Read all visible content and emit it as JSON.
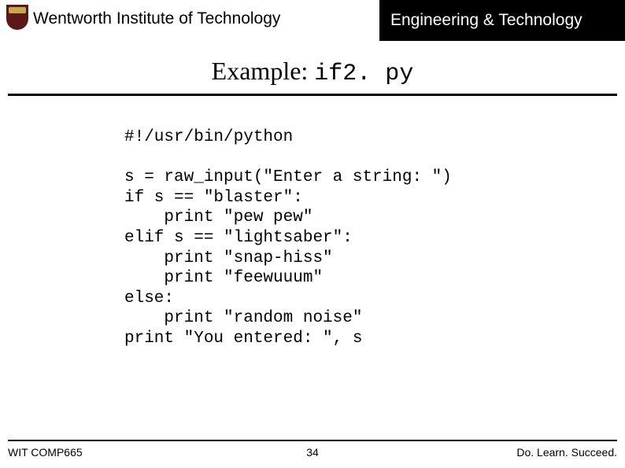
{
  "header": {
    "institution": "Wentworth Institute of Technology",
    "department": "Engineering & Technology"
  },
  "title": {
    "prefix": "Example: ",
    "filename": "if2. py"
  },
  "code": {
    "line1": "#!/usr/bin/python",
    "body": "s = raw_input(\"Enter a string: \")\nif s == \"blaster\":\n    print \"pew pew\"\nelif s == \"lightsaber\":\n    print \"snap-hiss\"\n    print \"feewuuum\"\nelse:\n    print \"random noise\"\nprint \"You entered: \", s"
  },
  "footer": {
    "course": "WIT COMP665",
    "page": "34",
    "motto": "Do. Learn. Succeed."
  }
}
